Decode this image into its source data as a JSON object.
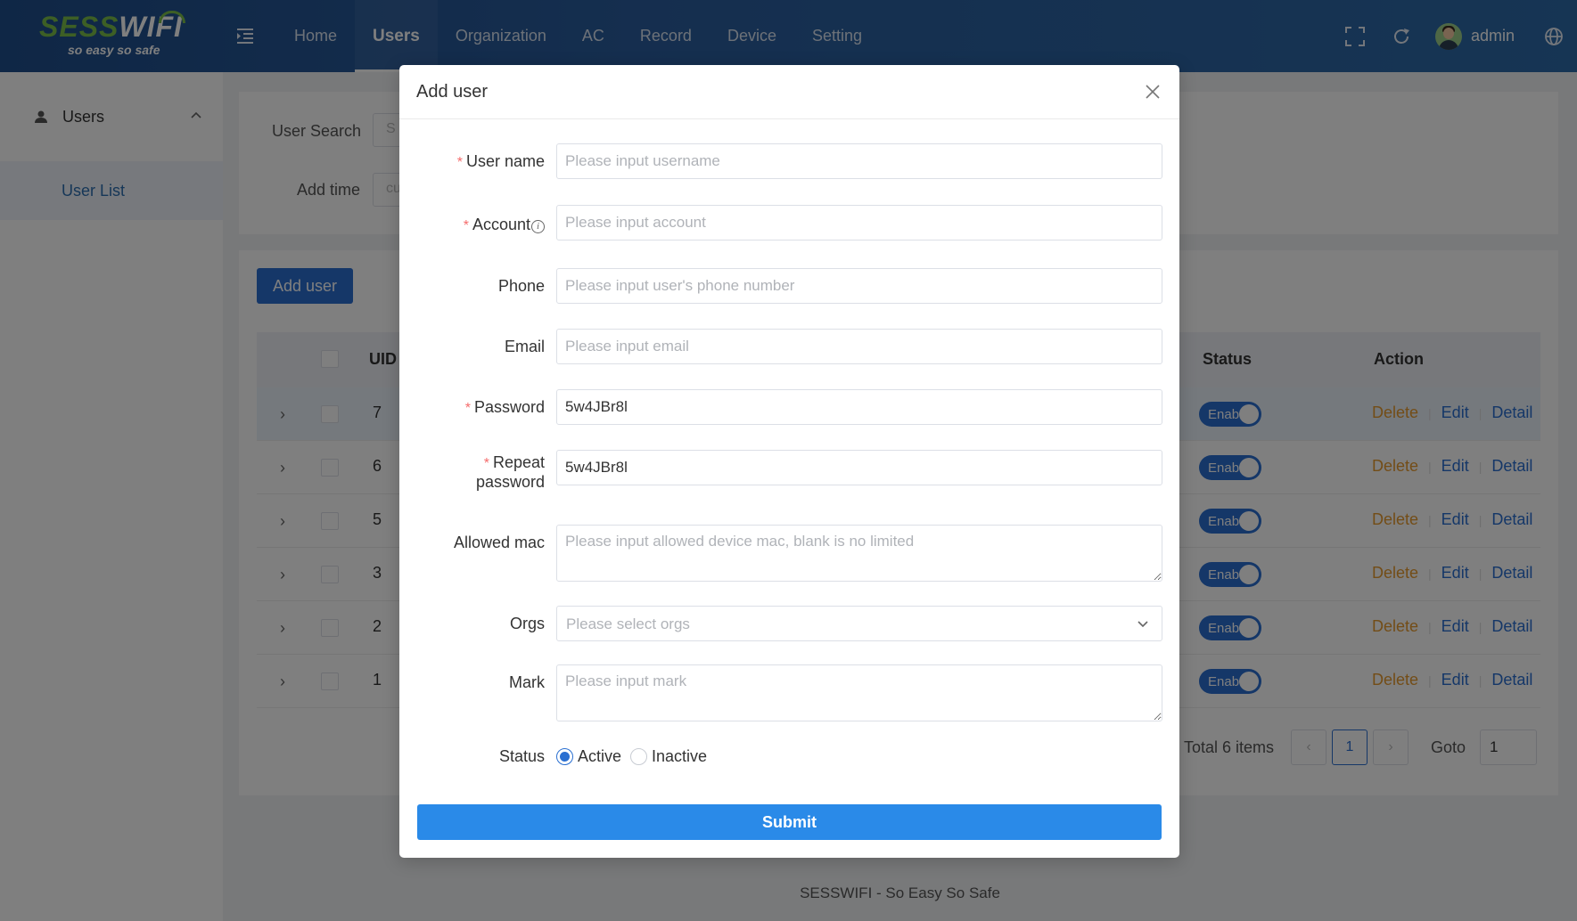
{
  "brand": {
    "logo_main": "SESS",
    "logo_wifi": "WIFI",
    "logo_sub": "so easy so safe"
  },
  "nav": {
    "items": [
      "Home",
      "Users",
      "Organization",
      "AC",
      "Record",
      "Device",
      "Setting"
    ],
    "active": "Users"
  },
  "header": {
    "username": "admin"
  },
  "sidebar": {
    "group_label": "Users",
    "sub_item": "User List"
  },
  "search": {
    "user_search_label": "User Search",
    "user_search_placeholder": "S",
    "add_time_label": "Add time",
    "add_time_placeholder": "cu"
  },
  "list": {
    "add_user_label": "Add user",
    "columns": {
      "uid": "UID",
      "status": "Status",
      "action": "Action"
    },
    "rows": [
      {
        "uid": "7",
        "status": "Enab"
      },
      {
        "uid": "6",
        "status": "Enab"
      },
      {
        "uid": "5",
        "status": "Enab"
      },
      {
        "uid": "3",
        "status": "Enab"
      },
      {
        "uid": "2",
        "status": "Enab"
      },
      {
        "uid": "1",
        "status": "Enab"
      }
    ],
    "actions": {
      "delete": "Delete",
      "edit": "Edit",
      "detail": "Detail"
    }
  },
  "pagination": {
    "total": "Total 6 items",
    "current_page": "1",
    "goto_label": "Goto",
    "goto_value": "1"
  },
  "footer": {
    "text": "SESSWIFI - So Easy So Safe"
  },
  "modal": {
    "title": "Add user",
    "fields": {
      "username": {
        "label": "User name",
        "placeholder": "Please input username"
      },
      "account": {
        "label": "Account",
        "placeholder": "Please input account"
      },
      "phone": {
        "label": "Phone",
        "placeholder": "Please input user's phone number"
      },
      "email": {
        "label": "Email",
        "placeholder": "Please input email"
      },
      "password": {
        "label": "Password",
        "value": "5w4JBr8l"
      },
      "repeat_password": {
        "label_line1": "Repeat",
        "label_line2": "password",
        "value": "5w4JBr8l"
      },
      "allowed_mac": {
        "label": "Allowed mac",
        "placeholder": "Please input allowed device mac, blank is no limited"
      },
      "orgs": {
        "label": "Orgs",
        "placeholder": "Please select orgs"
      },
      "mark": {
        "label": "Mark",
        "placeholder": "Please input mark"
      },
      "status": {
        "label": "Status",
        "options": [
          "Active",
          "Inactive"
        ],
        "selected": "Active"
      }
    },
    "required_mark": "*",
    "submit_label": "Submit"
  },
  "colors": {
    "primary": "#2a6fd1",
    "submit": "#2a8ae8",
    "delete": "#e69a2e",
    "required": "#f56c6c",
    "topbar": "#2a5d9e"
  }
}
